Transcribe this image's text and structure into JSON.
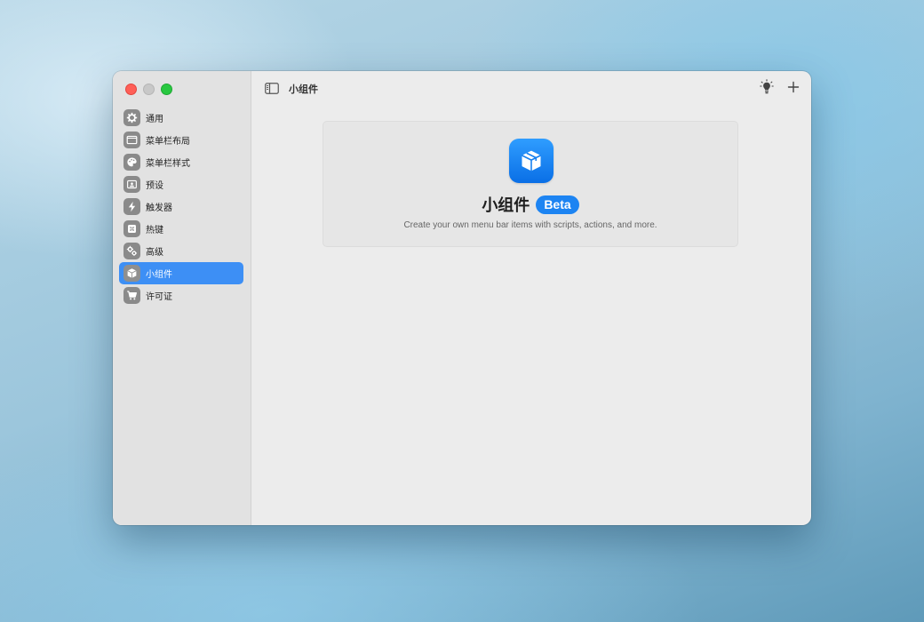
{
  "window": {
    "title": "小组件"
  },
  "sidebar": {
    "items": [
      {
        "label": "通用",
        "icon": "gear-icon"
      },
      {
        "label": "菜单栏布局",
        "icon": "menubar-layout-icon"
      },
      {
        "label": "菜单栏样式",
        "icon": "palette-icon"
      },
      {
        "label": "预设",
        "icon": "preset-icon"
      },
      {
        "label": "触发器",
        "icon": "bolt-icon"
      },
      {
        "label": "热键",
        "icon": "command-key-icon"
      },
      {
        "label": "高级",
        "icon": "gears-icon"
      },
      {
        "label": "小组件",
        "icon": "cube-icon",
        "active": true
      },
      {
        "label": "许可证",
        "icon": "cart-icon"
      }
    ]
  },
  "toolbar": {
    "left_icon": "sidebar-toggle-icon",
    "right_icons": [
      "lightbulb-icon",
      "plus-icon"
    ]
  },
  "hero": {
    "icon": "cube-icon",
    "title": "小组件",
    "badge": "Beta",
    "subtitle": "Create your own menu bar items with scripts, actions, and more."
  },
  "colors": {
    "accent": "#3d8ff5",
    "badge": "#1d84f2",
    "sidebar_bg": "#e2e2e2",
    "content_bg": "#ececec"
  }
}
